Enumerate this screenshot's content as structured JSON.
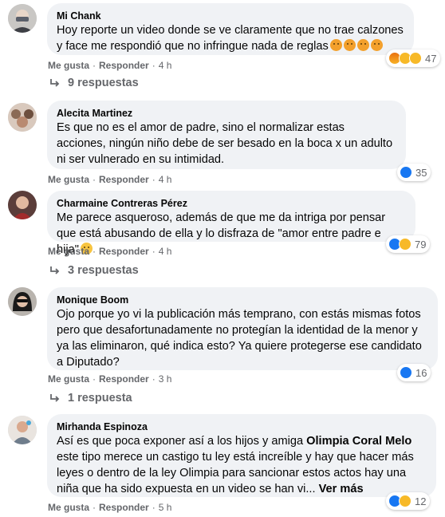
{
  "labels": {
    "like": "Me gusta",
    "reply": "Responder",
    "see_more": "Ver más"
  },
  "comments": [
    {
      "author": "Mi Chank",
      "text": "Hoy reporte un video donde se ve claramente que no trae calzones y face me respondió que no infringue nada de reglas",
      "time": "4 h",
      "reactions": "47",
      "reaction_icons": [
        "angry-icon",
        "sad-icon",
        "wow-icon"
      ],
      "replies": "9 respuestas"
    },
    {
      "author": "Alecita Martinez",
      "text": "Es que no es el amor de padre, sino el normalizar estas acciones, ningún niño debe de ser besado en la boca x un adulto ni ser vulnerado en su intimidad.",
      "time": "4 h",
      "reactions": "35",
      "reaction_icons": [
        "like-icon"
      ],
      "replies": ""
    },
    {
      "author": "Charmaine Contreras Pérez",
      "text": "Me parece asqueroso, además de que me da intriga por pensar que está abusando de ella y lo disfraza de \"amor entre padre e hija\"",
      "time": "4 h",
      "reactions": "79",
      "reaction_icons": [
        "like-icon",
        "sad-icon"
      ],
      "replies": "3 respuestas"
    },
    {
      "author": "Monique Boom",
      "text": "Ojo porque yo vi la publicación más temprano, con estás mismas fotos pero que desafortunadamente no protegían la identidad de la menor y ya las eliminaron, qué indica esto? Ya quiere protegerse ese candidato a Diputado?",
      "time": "3 h",
      "reactions": "16",
      "reaction_icons": [
        "like-icon"
      ],
      "replies": "1 respuesta"
    },
    {
      "author": "Mirhanda Espinoza",
      "text_before": "Así es que poca exponer así a los hijos y amiga ",
      "mention": "Olimpia Coral Melo",
      "text_after": " este tipo merece un castigo tu ley está increíble y hay que hacer más leyes o dentro de la ley Olimpia para sancionar estos actos hay una niña que ha sido expuesta en un video se han vi... ",
      "time": "5 h",
      "reactions": "12",
      "reaction_icons": [
        "like-icon",
        "sad-icon"
      ],
      "replies": ""
    }
  ],
  "colors": {
    "bubble": "#f0f2f5",
    "meta": "#65676b",
    "like": "#1877f2"
  }
}
